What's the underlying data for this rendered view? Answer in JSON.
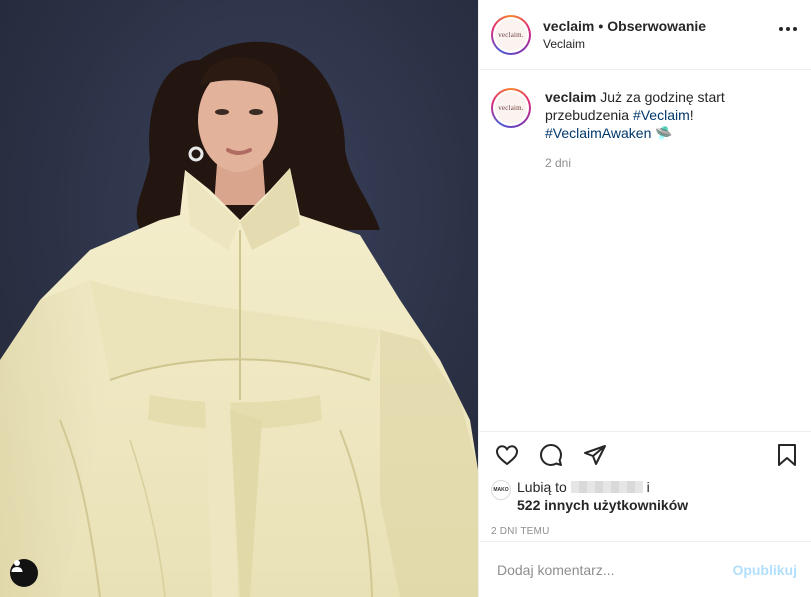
{
  "header": {
    "avatar_logo_text": "veclaim.",
    "username": "veclaim",
    "separator": "•",
    "follow_label": "Obserwowanie",
    "subtitle": "Veclaim"
  },
  "caption": {
    "avatar_logo_text": "veclaim.",
    "username": "veclaim",
    "text": "Już za godzinę start przebudzenia",
    "hashtag1": "#Veclaim",
    "after_hashtag1": "!",
    "hashtag2": "#VeclaimAwaken",
    "emoji": "🛸",
    "age": "2 dni"
  },
  "actions": {
    "like_icon": "heart-icon",
    "comment_icon": "comment-icon",
    "share_icon": "paper-plane-icon",
    "save_icon": "bookmark-icon"
  },
  "likes": {
    "liker_avatar_text": "MAKO",
    "prefix": "Lubią to",
    "suffix": "i",
    "count_text": "522 innych użytkowników"
  },
  "timestamp": "2 DNI TEMU",
  "comment": {
    "placeholder": "Dodaj komentarz...",
    "publish_label": "Opublikuj"
  },
  "colors": {
    "hashtag": "#00376b",
    "publish_disabled": "#b2dffc",
    "muted": "#8e8e8e",
    "coat": "#f1ecc7"
  }
}
